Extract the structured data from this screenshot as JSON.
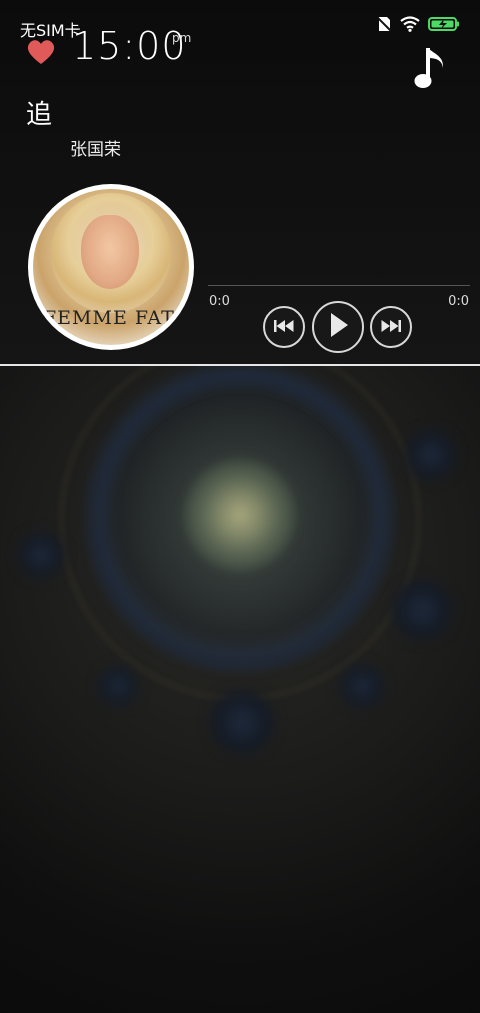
{
  "status_bar": {
    "carrier": "无SIM卡",
    "icons": [
      "no-sim-icon",
      "wifi-icon",
      "battery-charging-icon"
    ]
  },
  "lock_clock": {
    "time": "15:00",
    "ampm": "pm"
  },
  "player": {
    "song_title": "追",
    "artist": "张国荣",
    "album_text": "FEMME FATA",
    "time_elapsed": "0:0",
    "time_total": "0:0",
    "progress": 0,
    "controls": {
      "prev_icon": "skip-previous-icon",
      "play_icon": "play-icon",
      "next_icon": "skip-next-icon"
    },
    "favorite_icon": "heart-icon",
    "music_icon": "music-note-icon"
  },
  "colors": {
    "heart": "#e05a5a",
    "battery_fill": "#4cd964",
    "control_border": "#d8d8d8",
    "divider": "#e6e6e6"
  }
}
